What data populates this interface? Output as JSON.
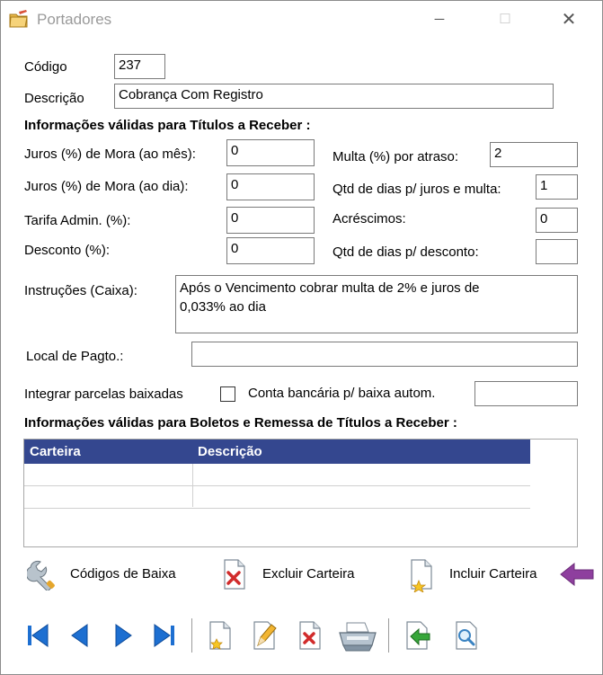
{
  "window": {
    "title": "Portadores",
    "minimize_symbol": "─",
    "maximize_symbol": "☐",
    "close_symbol": "✕"
  },
  "form": {
    "codigo_label": "Código",
    "codigo_value": "237",
    "descricao_label": "Descrição",
    "descricao_value": "Cobrança Com Registro",
    "section_receber": "Informações válidas para Títulos a Receber :",
    "juros_mes_label": "Juros (%) de Mora (ao mês):",
    "juros_mes_value": "0",
    "juros_dia_label": "Juros (%) de Mora (ao dia):",
    "juros_dia_value": "0",
    "tarifa_label": "Tarifa Admin. (%):",
    "tarifa_value": "0",
    "desconto_label": "Desconto (%):",
    "desconto_value": "0",
    "multa_label": "Multa (%) por atraso:",
    "multa_value": "2",
    "qtd_juros_label": "Qtd de dias p/ juros e multa:",
    "qtd_juros_value": "1",
    "acrescimos_label": "Acréscimos:",
    "acrescimos_value": "0",
    "qtd_desconto_label": "Qtd de dias p/ desconto:",
    "qtd_desconto_value": "",
    "instrucoes_label": "Instruções (Caixa):",
    "instrucoes_value": "Após o Vencimento cobrar multa de 2% e juros de\n0,033% ao dia",
    "local_label": "Local de Pagto.:",
    "local_value": "",
    "integrar_label": "Integrar parcelas baixadas",
    "conta_label": "Conta bancária p/ baixa autom.",
    "conta_value": "",
    "section_boletos": "Informações válidas para Boletos e Remessa de Títulos a Receber :"
  },
  "grid": {
    "columns": [
      "Carteira",
      "Descrição"
    ],
    "header_color": "#34478f"
  },
  "actions": {
    "codigos_baixa": "Códigos de Baixa",
    "excluir_carteira": "Excluir Carteira",
    "incluir_carteira": "Incluir Carteira",
    "arrow_color": "#8e3f9e"
  },
  "toolbar": {
    "icons": [
      "first-record-icon",
      "prev-record-icon",
      "next-record-icon",
      "last-record-icon",
      "new-record-icon",
      "edit-record-icon",
      "delete-record-icon",
      "print-icon",
      "exit-icon",
      "search-icon"
    ]
  }
}
